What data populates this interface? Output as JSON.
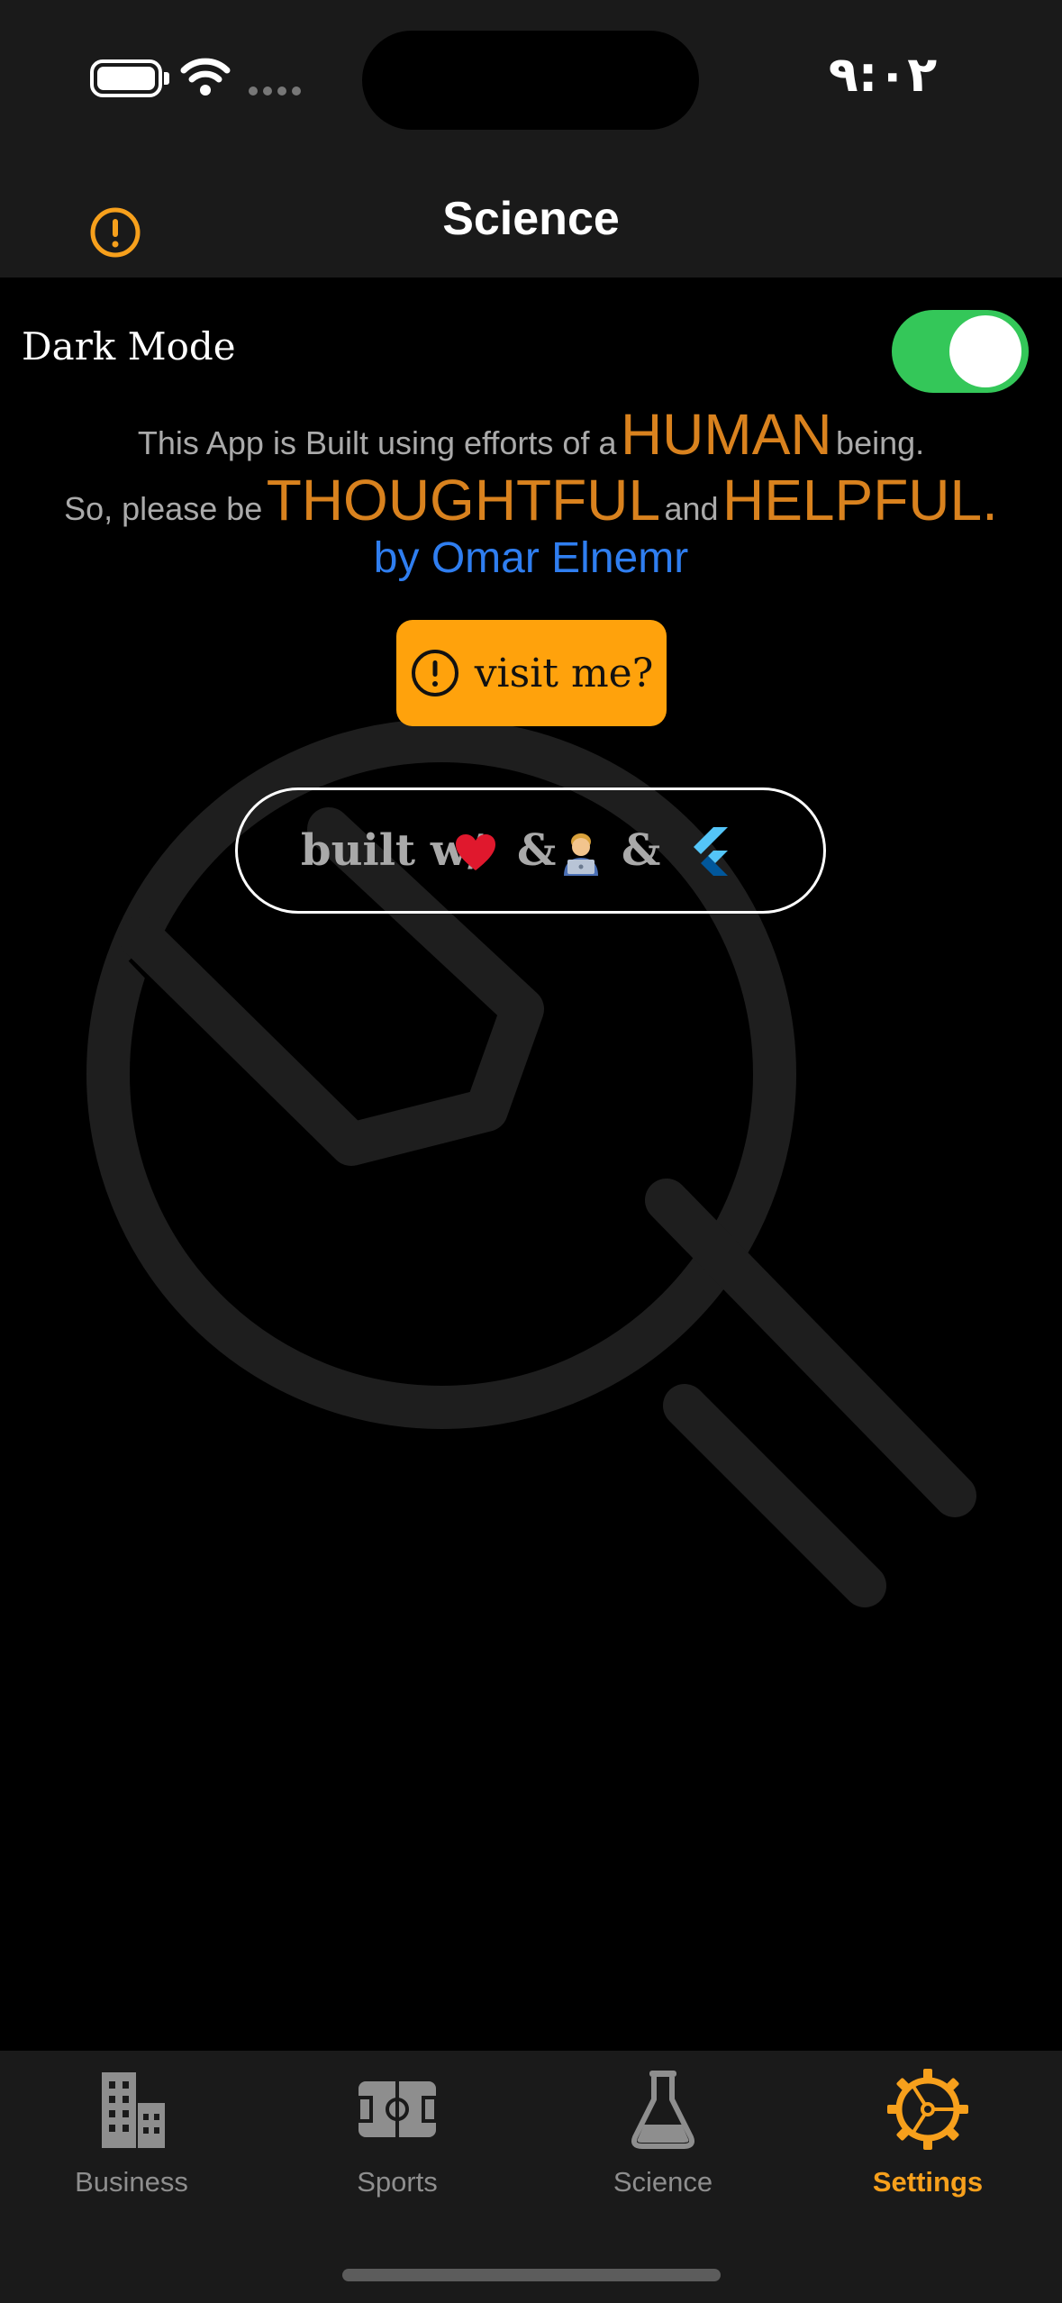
{
  "status_bar": {
    "time": "٩:٠٢"
  },
  "nav": {
    "title": "Science",
    "info_icon": "exclamation-circle-icon"
  },
  "settings": {
    "dark_mode_label": "Dark Mode",
    "dark_mode_on": true
  },
  "message": {
    "line1_pre": "This App is Built using efforts of a",
    "line1_big": "HUMAN",
    "line1_post": "being.",
    "line2_pre": "So, please be",
    "line2_big1": "THOUGHTFUL",
    "line2_mid": "and",
    "line2_big2": "HELPFUL.",
    "author": "by Omar Elnemr"
  },
  "visit_button": {
    "label": "visit me?",
    "icon": "exclamation-circle-icon"
  },
  "built_with": {
    "text": "built w/",
    "amp": "&",
    "icons": [
      "heart-icon",
      "developer-icon",
      "flutter-icon"
    ]
  },
  "tabs": [
    {
      "label": "Business",
      "icon": "building-icon",
      "active": false
    },
    {
      "label": "Sports",
      "icon": "field-icon",
      "active": false
    },
    {
      "label": "Science",
      "icon": "flask-icon",
      "active": false
    },
    {
      "label": "Settings",
      "icon": "gear-icon",
      "active": true
    }
  ],
  "colors": {
    "accent": "#f7a01c",
    "toggle_on": "#34c759",
    "link": "#2f7ef0",
    "highlight": "#d9821e"
  }
}
